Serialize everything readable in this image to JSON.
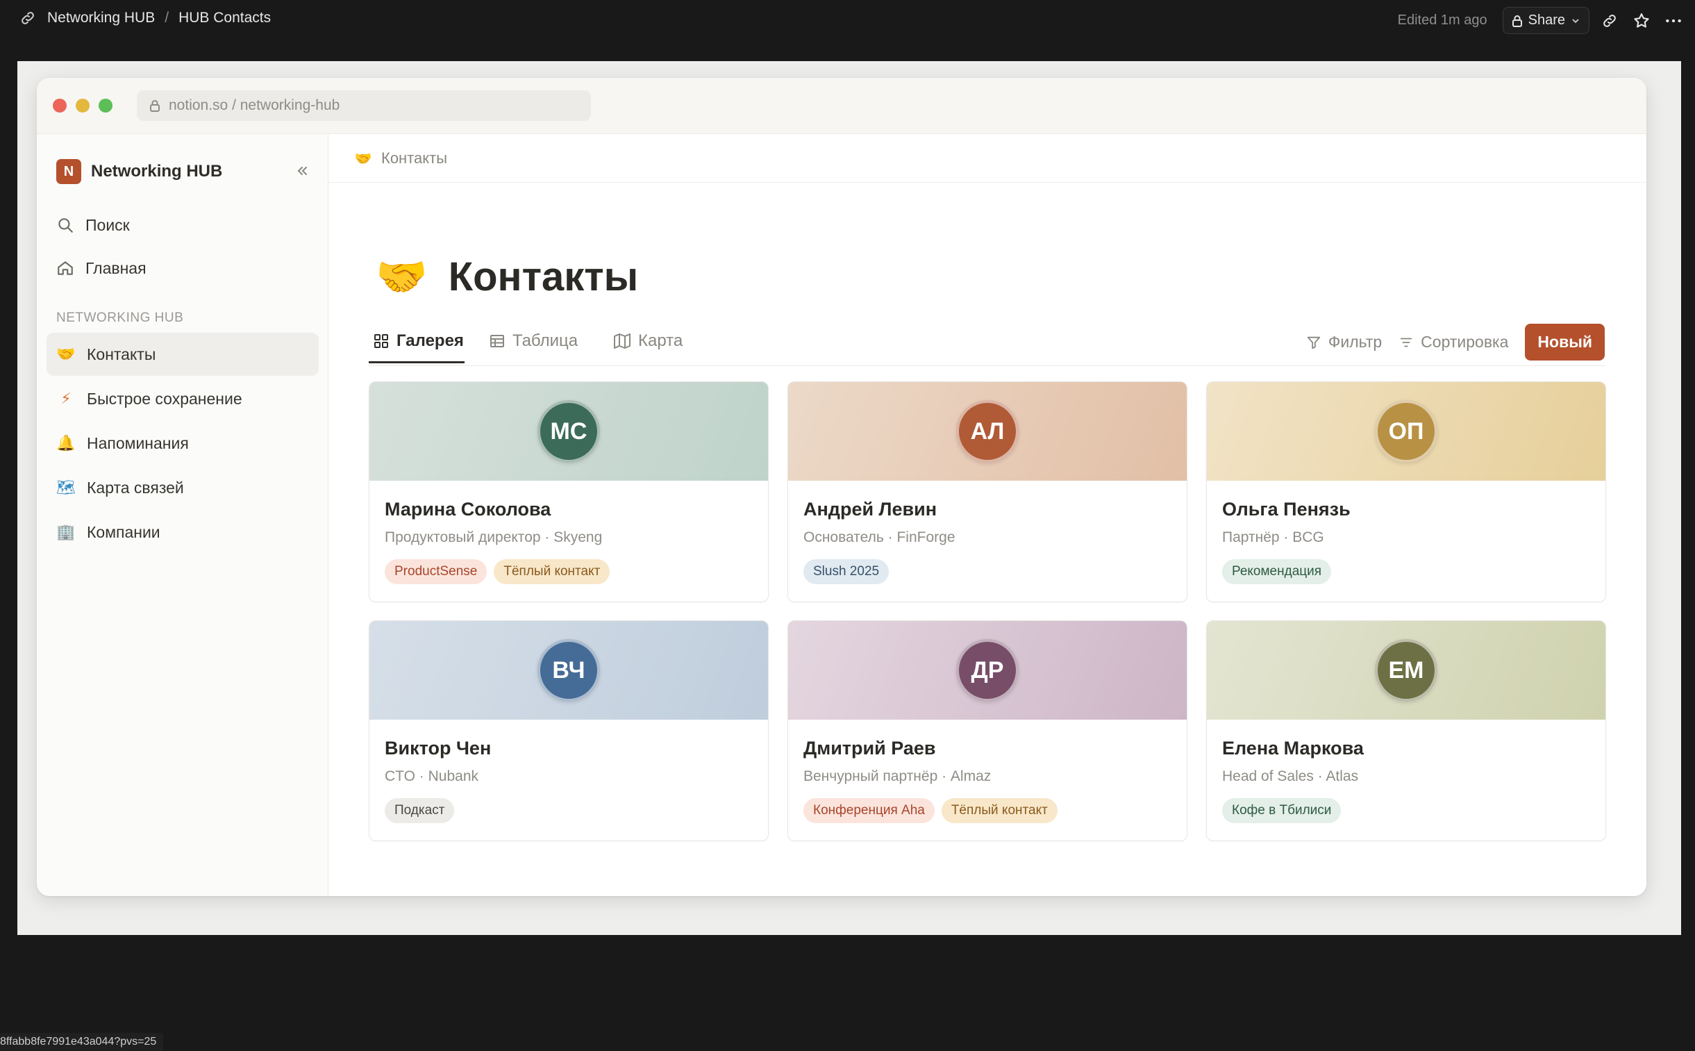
{
  "topbar": {
    "breadcrumb": [
      "Networking HUB",
      "HUB Contacts"
    ],
    "edited": "Edited 1m ago",
    "share": "Share"
  },
  "browser": {
    "url": "notion.so / networking-hub"
  },
  "sidebar": {
    "workspace_initial": "N",
    "workspace_name": "Networking HUB",
    "top_items": [
      {
        "label": "Поиск",
        "icon": "search-icon"
      },
      {
        "label": "Главная",
        "icon": "home-icon"
      }
    ],
    "section_label": "NETWORKING HUB",
    "pages": [
      {
        "label": "Контакты",
        "emoji": "🤝",
        "active": true
      },
      {
        "label": "Быстрое сохранение",
        "emoji": "⚡"
      },
      {
        "label": "Напоминания",
        "emoji": "🔔"
      },
      {
        "label": "Карта связей",
        "emoji": "🗺"
      },
      {
        "label": "Компании",
        "emoji": "🏢"
      }
    ]
  },
  "main": {
    "breadcrumb_emoji": "🤝",
    "breadcrumb": "Контакты",
    "page_emoji": "🤝",
    "title": "Контакты",
    "tabs": [
      {
        "label": "Галерея",
        "icon": "gallery-icon",
        "active": true
      },
      {
        "label": "Таблица",
        "icon": "table-icon"
      },
      {
        "label": "Карта",
        "icon": "map-icon"
      }
    ],
    "filter": "Фильтр",
    "sort": "Сортировка",
    "new_button": "Новый",
    "cards": [
      {
        "initials": "МС",
        "name": "Марина Соколова",
        "subtitle": "Продуктовый директор · Skyeng",
        "cover_from": "#d6e0db",
        "cover_to": "#bfd3ca",
        "avatar_color": "#3d6b5a",
        "tags": [
          {
            "text": "ProductSense",
            "bg": "#fbe4dc",
            "fg": "#a8452a"
          },
          {
            "text": "Тёплый контакт",
            "bg": "#f8e7c9",
            "fg": "#8a5a1c"
          }
        ]
      },
      {
        "initials": "АЛ",
        "name": "Андрей Левин",
        "subtitle": "Основатель · FinForge",
        "cover_from": "#ecd9c8",
        "cover_to": "#e2bfa6",
        "avatar_color": "#b05a36",
        "tags": [
          {
            "text": "Slush 2025",
            "bg": "#e1eaf0",
            "fg": "#35506a"
          }
        ]
      },
      {
        "initials": "ОП",
        "name": "Ольга Пенязь",
        "subtitle": "Партнёр · BCG",
        "cover_from": "#f1e3c6",
        "cover_to": "#e6cf9a",
        "avatar_color": "#b89144",
        "tags": [
          {
            "text": "Рекомендация",
            "bg": "#e3efe8",
            "fg": "#2f5a44"
          }
        ]
      },
      {
        "initials": "ВЧ",
        "name": "Виктор Чен",
        "subtitle": "CTO · Nubank",
        "cover_from": "#d6dfe8",
        "cover_to": "#bfcddc",
        "avatar_color": "#456c96",
        "tags": [
          {
            "text": "Подкаст",
            "bg": "#ecebe8",
            "fg": "#4a4843"
          }
        ]
      },
      {
        "initials": "ДР",
        "name": "Дмитрий Раев",
        "subtitle": "Венчурный партнёр · Almaz",
        "cover_from": "#e4d6df",
        "cover_to": "#cdb6c7",
        "avatar_color": "#774d68",
        "tags": [
          {
            "text": "Конференция Aha",
            "bg": "#fbe4dc",
            "fg": "#a8452a"
          },
          {
            "text": "Тёплый контакт",
            "bg": "#f8e7c9",
            "fg": "#8a5a1c"
          }
        ]
      },
      {
        "initials": "ЕМ",
        "name": "Елена Маркова",
        "subtitle": "Head of Sales · Atlas",
        "cover_from": "#e3e5d2",
        "cover_to": "#cfd2ae",
        "avatar_color": "#6d7044",
        "tags": [
          {
            "text": "Кофе в Тбилиси",
            "bg": "#e3efe8",
            "fg": "#2f5a44"
          }
        ]
      }
    ]
  },
  "status_url": "8ffabb8fe7991e43a044?pvs=25"
}
